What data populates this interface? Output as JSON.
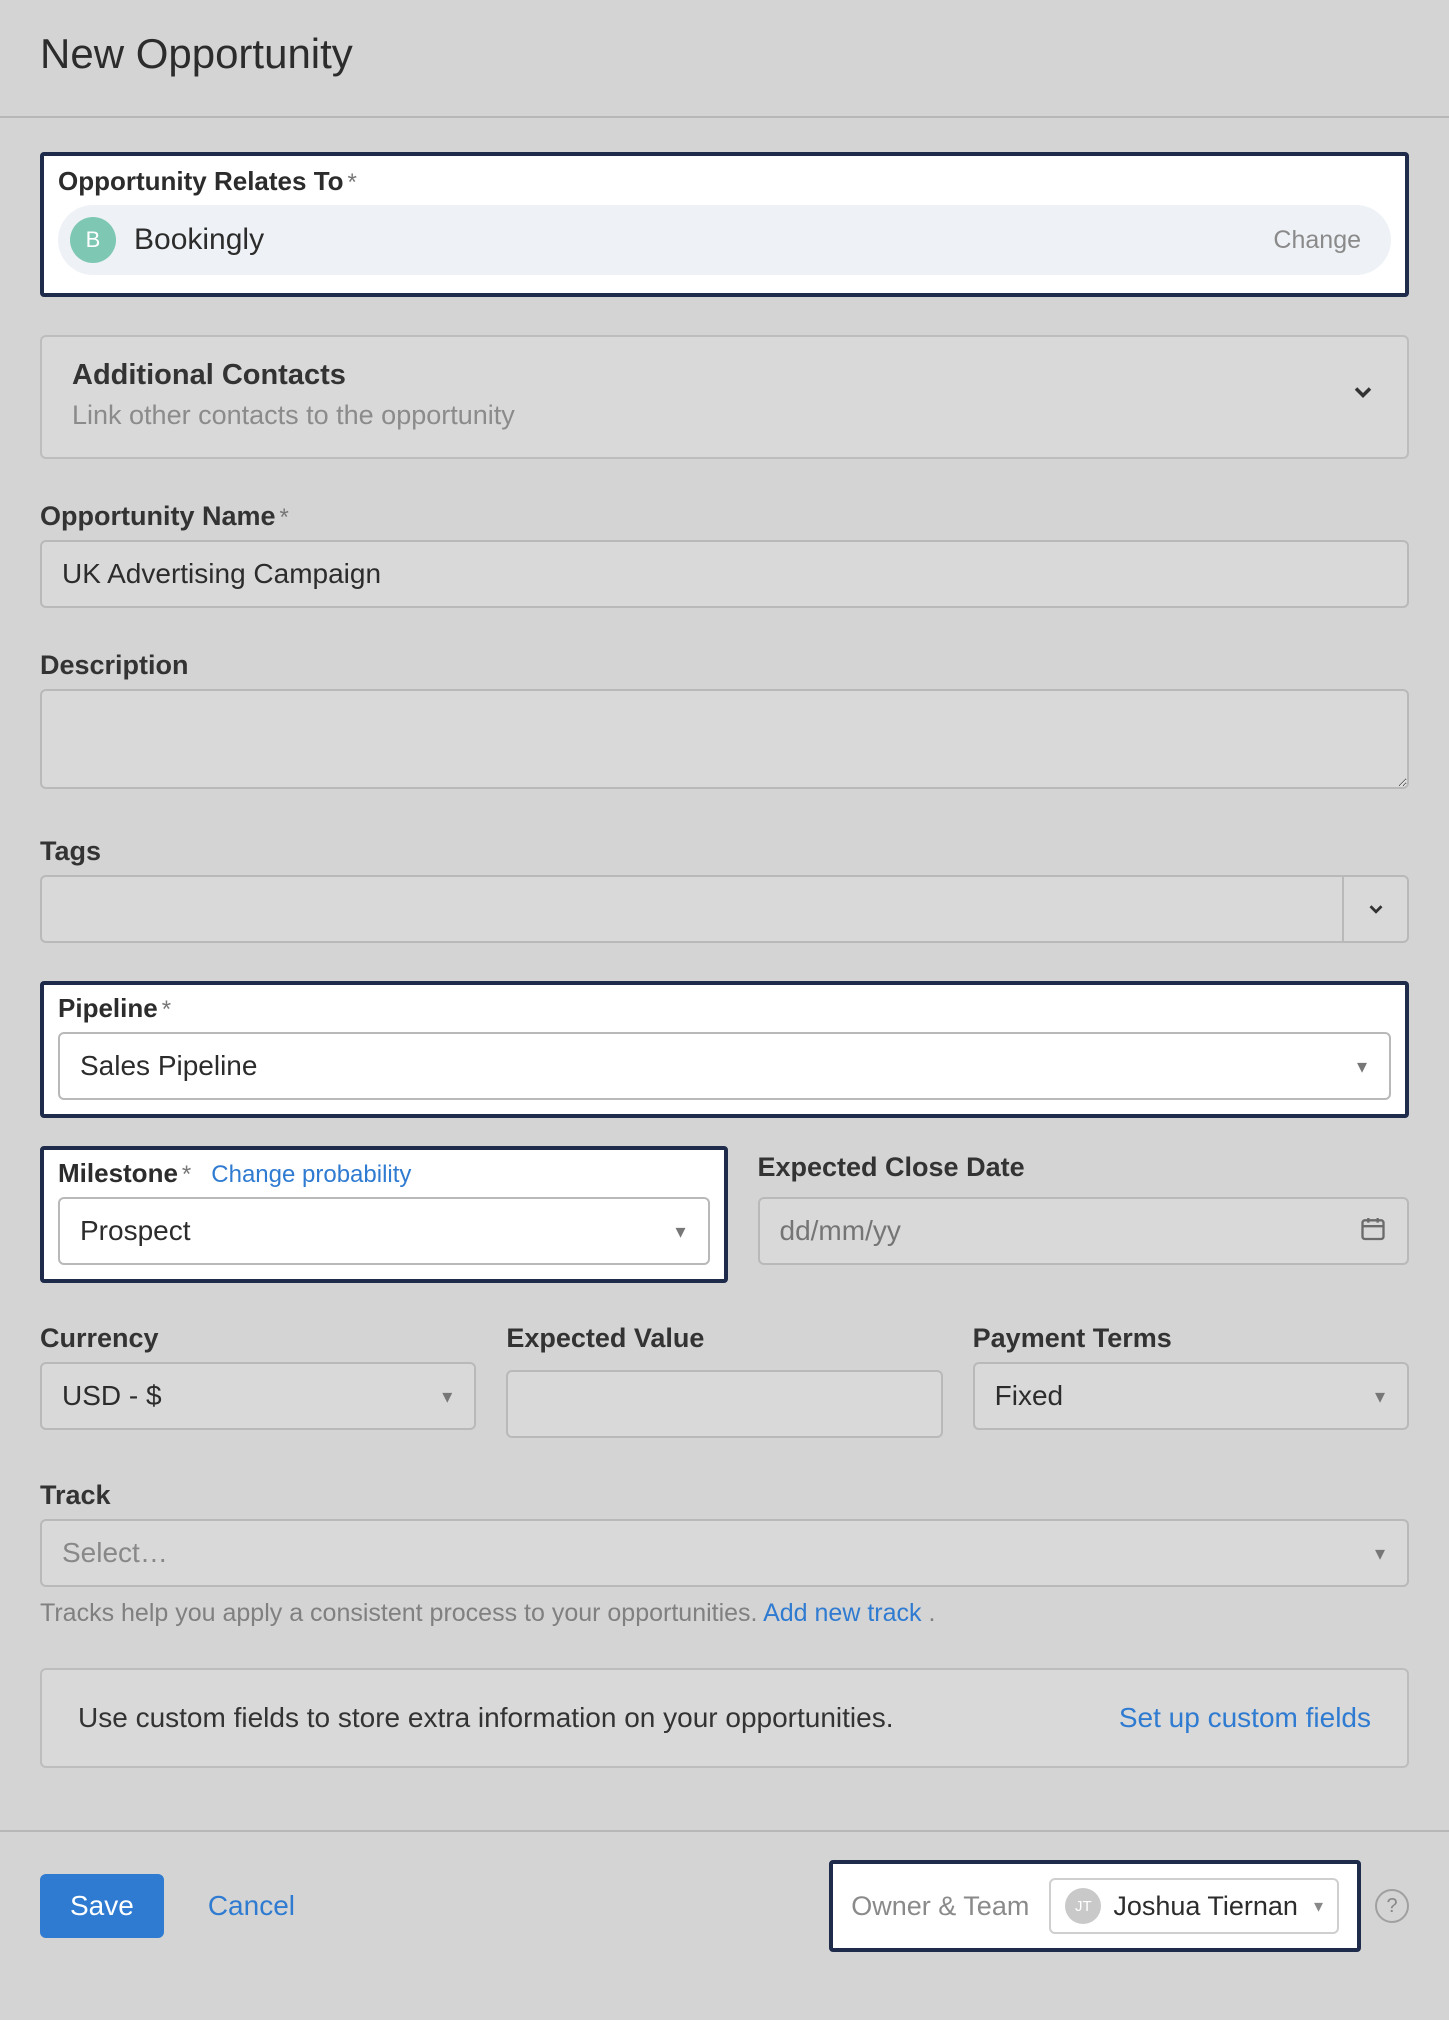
{
  "modal": {
    "title": "New Opportunity"
  },
  "relates": {
    "label": "Opportunity Relates To",
    "avatar_initial": "B",
    "account_name": "Bookingly",
    "change": "Change"
  },
  "additional_contacts": {
    "title": "Additional Contacts",
    "subtitle": "Link other contacts to the opportunity"
  },
  "opp_name": {
    "label": "Opportunity Name",
    "value": "UK Advertising Campaign"
  },
  "description": {
    "label": "Description",
    "value": ""
  },
  "tags": {
    "label": "Tags",
    "value": ""
  },
  "pipeline": {
    "label": "Pipeline",
    "value": "Sales Pipeline"
  },
  "milestone": {
    "label": "Milestone",
    "change_prob": "Change probability",
    "value": "Prospect"
  },
  "close_date": {
    "label": "Expected Close Date",
    "placeholder": "dd/mm/yy"
  },
  "currency": {
    "label": "Currency",
    "value": "USD - $"
  },
  "expected_value": {
    "label": "Expected Value",
    "value": ""
  },
  "payment_terms": {
    "label": "Payment Terms",
    "value": "Fixed"
  },
  "track": {
    "label": "Track",
    "placeholder": "Select…",
    "help": "Tracks help you apply a consistent process to your opportunities. ",
    "add_link": "Add new track",
    "period": " ."
  },
  "custom_fields": {
    "text": "Use custom fields to store extra information on your opportunities.",
    "link": "Set up custom fields"
  },
  "footer": {
    "save": "Save",
    "cancel": "Cancel",
    "owner_label": "Owner & Team",
    "owner_initials": "JT",
    "owner_name": "Joshua Tiernan"
  }
}
